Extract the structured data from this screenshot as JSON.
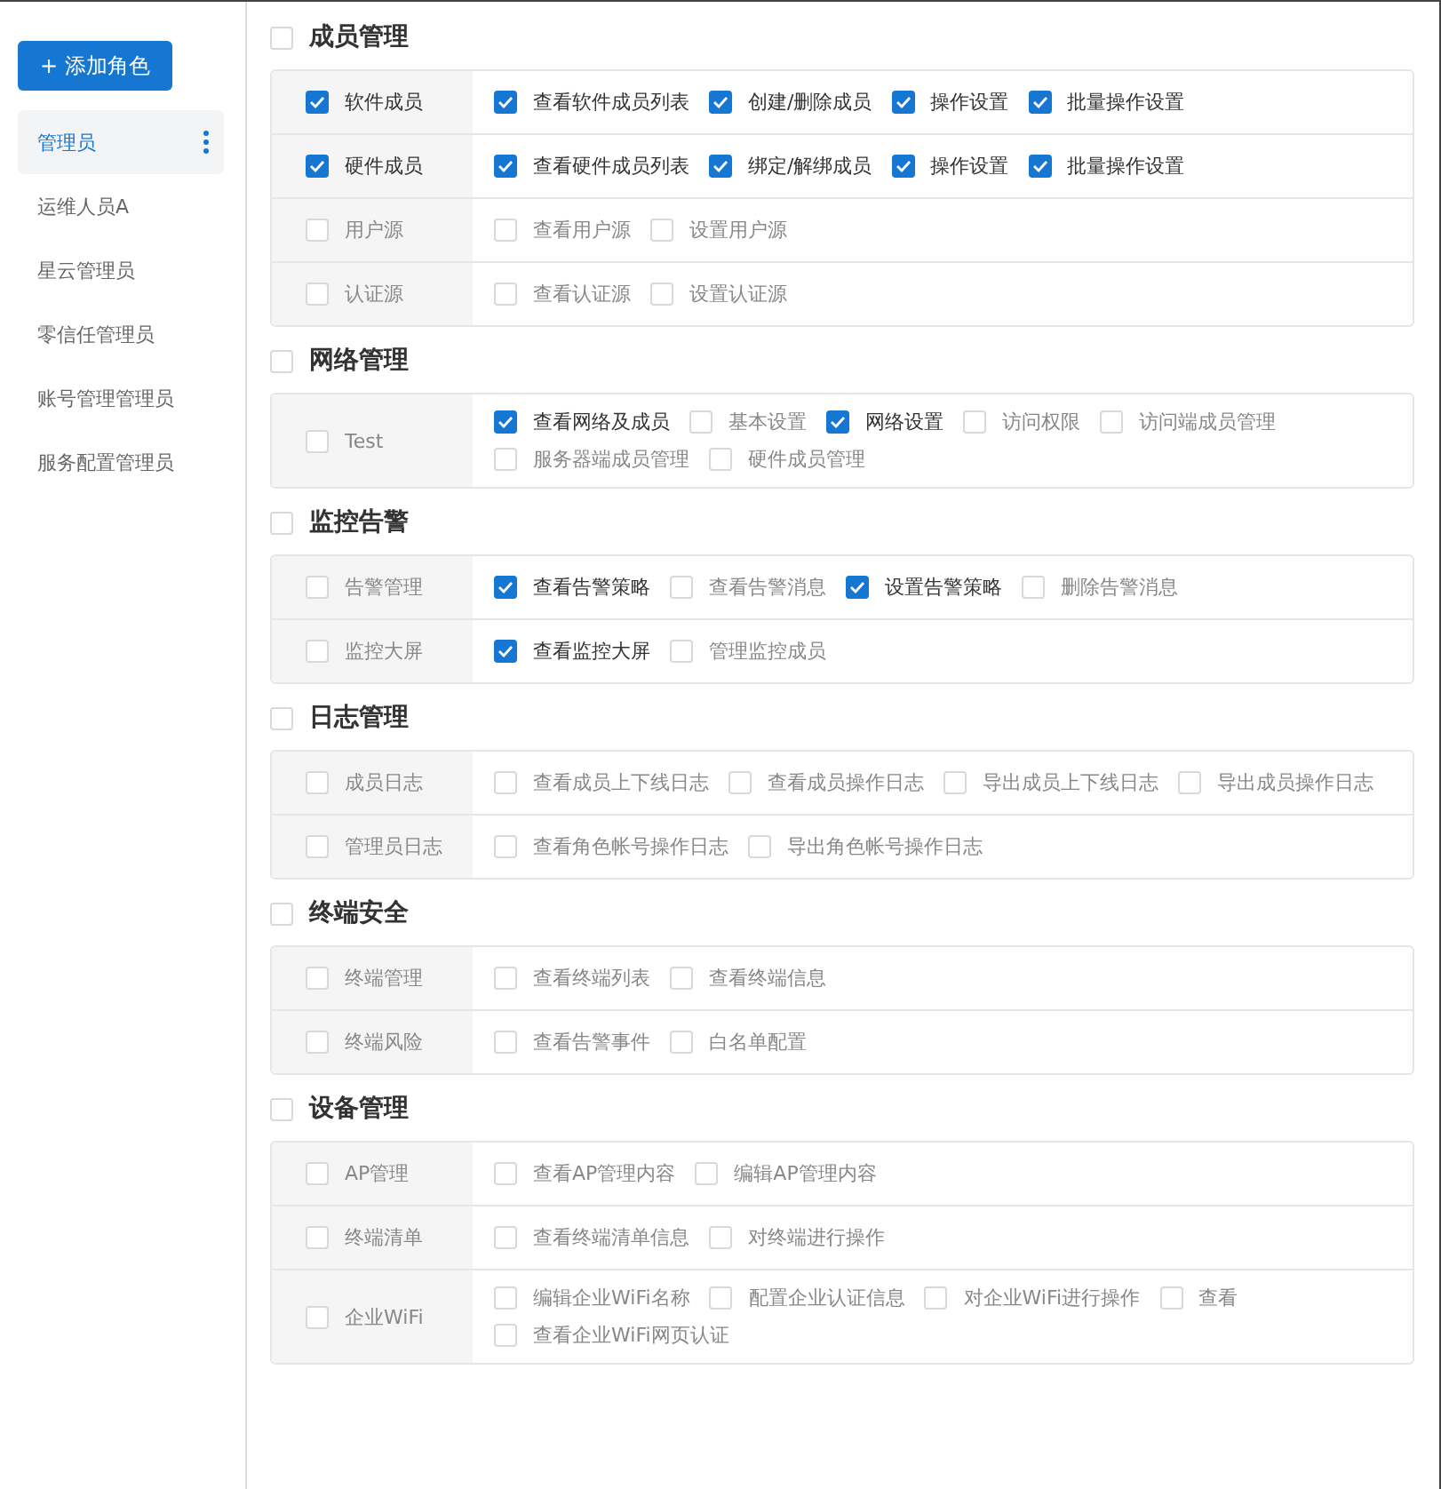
{
  "add_button": {
    "icon": "+",
    "label": "添加角色"
  },
  "roles": [
    {
      "name": "管理员",
      "selected": true
    },
    {
      "name": "运维人员A",
      "selected": false
    },
    {
      "name": "星云管理员",
      "selected": false
    },
    {
      "name": "零信任管理员",
      "selected": false
    },
    {
      "name": "账号管理管理员",
      "selected": false
    },
    {
      "name": "服务配置管理员",
      "selected": false
    }
  ],
  "sections": [
    {
      "title": "成员管理",
      "checked": false,
      "rows": [
        {
          "label": "软件成员",
          "checked": true,
          "permissions": [
            {
              "label": "查看软件成员列表",
              "checked": true
            },
            {
              "label": "创建/删除成员",
              "checked": true
            },
            {
              "label": "操作设置",
              "checked": true
            },
            {
              "label": "批量操作设置",
              "checked": true
            }
          ]
        },
        {
          "label": "硬件成员",
          "checked": true,
          "permissions": [
            {
              "label": "查看硬件成员列表",
              "checked": true
            },
            {
              "label": "绑定/解绑成员",
              "checked": true
            },
            {
              "label": "操作设置",
              "checked": true
            },
            {
              "label": "批量操作设置",
              "checked": true
            }
          ]
        },
        {
          "label": "用户源",
          "checked": false,
          "permissions": [
            {
              "label": "查看用户源",
              "checked": false
            },
            {
              "label": "设置用户源",
              "checked": false
            }
          ]
        },
        {
          "label": "认证源",
          "checked": false,
          "permissions": [
            {
              "label": "查看认证源",
              "checked": false
            },
            {
              "label": "设置认证源",
              "checked": false
            }
          ]
        }
      ]
    },
    {
      "title": "网络管理",
      "checked": false,
      "rows": [
        {
          "label": "Test",
          "checked": false,
          "permissions": [
            {
              "label": "查看网络及成员",
              "checked": true
            },
            {
              "label": "基本设置",
              "checked": false
            },
            {
              "label": "网络设置",
              "checked": true
            },
            {
              "label": "访问权限",
              "checked": false
            },
            {
              "label": "访问端成员管理",
              "checked": false
            },
            {
              "label": "服务器端成员管理",
              "checked": false
            },
            {
              "label": "硬件成员管理",
              "checked": false
            }
          ]
        }
      ]
    },
    {
      "title": "监控告警",
      "checked": false,
      "rows": [
        {
          "label": "告警管理",
          "checked": false,
          "permissions": [
            {
              "label": "查看告警策略",
              "checked": true
            },
            {
              "label": "查看告警消息",
              "checked": false
            },
            {
              "label": "设置告警策略",
              "checked": true
            },
            {
              "label": "删除告警消息",
              "checked": false
            }
          ]
        },
        {
          "label": "监控大屏",
          "checked": false,
          "permissions": [
            {
              "label": "查看监控大屏",
              "checked": true
            },
            {
              "label": "管理监控成员",
              "checked": false
            }
          ]
        }
      ]
    },
    {
      "title": "日志管理",
      "checked": false,
      "rows": [
        {
          "label": "成员日志",
          "checked": false,
          "permissions": [
            {
              "label": "查看成员上下线日志",
              "checked": false
            },
            {
              "label": "查看成员操作日志",
              "checked": false
            },
            {
              "label": "导出成员上下线日志",
              "checked": false
            },
            {
              "label": "导出成员操作日志",
              "checked": false
            }
          ]
        },
        {
          "label": "管理员日志",
          "checked": false,
          "permissions": [
            {
              "label": "查看角色帐号操作日志",
              "checked": false
            },
            {
              "label": "导出角色帐号操作日志",
              "checked": false
            }
          ]
        }
      ]
    },
    {
      "title": "终端安全",
      "checked": false,
      "rows": [
        {
          "label": "终端管理",
          "checked": false,
          "permissions": [
            {
              "label": "查看终端列表",
              "checked": false
            },
            {
              "label": "查看终端信息",
              "checked": false
            }
          ]
        },
        {
          "label": "终端风险",
          "checked": false,
          "permissions": [
            {
              "label": "查看告警事件",
              "checked": false
            },
            {
              "label": "白名单配置",
              "checked": false
            }
          ]
        }
      ]
    },
    {
      "title": "设备管理",
      "checked": false,
      "rows": [
        {
          "label": "AP管理",
          "checked": false,
          "permissions": [
            {
              "label": "查看AP管理内容",
              "checked": false
            },
            {
              "label": "编辑AP管理内容",
              "checked": false
            }
          ]
        },
        {
          "label": "终端清单",
          "checked": false,
          "permissions": [
            {
              "label": "查看终端清单信息",
              "checked": false
            },
            {
              "label": "对终端进行操作",
              "checked": false
            }
          ]
        },
        {
          "label": "企业WiFi",
          "checked": false,
          "permissions": [
            {
              "label": "编辑企业WiFi名称",
              "checked": false
            },
            {
              "label": "配置企业认证信息",
              "checked": false
            },
            {
              "label": "对企业WiFi进行操作",
              "checked": false
            },
            {
              "label": "查看",
              "checked": false
            },
            {
              "label": "查看企业WiFi网页认证",
              "checked": false
            }
          ]
        }
      ]
    }
  ]
}
